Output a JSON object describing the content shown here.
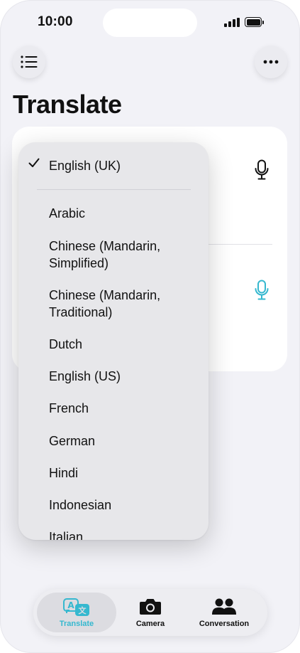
{
  "status_bar": {
    "time": "10:00"
  },
  "header": {
    "title": "Translate"
  },
  "dropdown": {
    "selected": "English (UK)",
    "options": [
      "Arabic",
      "Chinese (Mandarin, Simplified)",
      "Chinese (Mandarin, Traditional)",
      "Dutch",
      "English (US)",
      "French",
      "German",
      "Hindi",
      "Indonesian",
      "Italian"
    ]
  },
  "tabs": [
    {
      "label": "Translate",
      "icon": "translate-icon",
      "active": true
    },
    {
      "label": "Camera",
      "icon": "camera-icon",
      "active": false
    },
    {
      "label": "Conversation",
      "icon": "people-icon",
      "active": false
    }
  ],
  "colors": {
    "accent": "#35b8cf",
    "background": "#f2f2f7",
    "text": "#111111"
  }
}
